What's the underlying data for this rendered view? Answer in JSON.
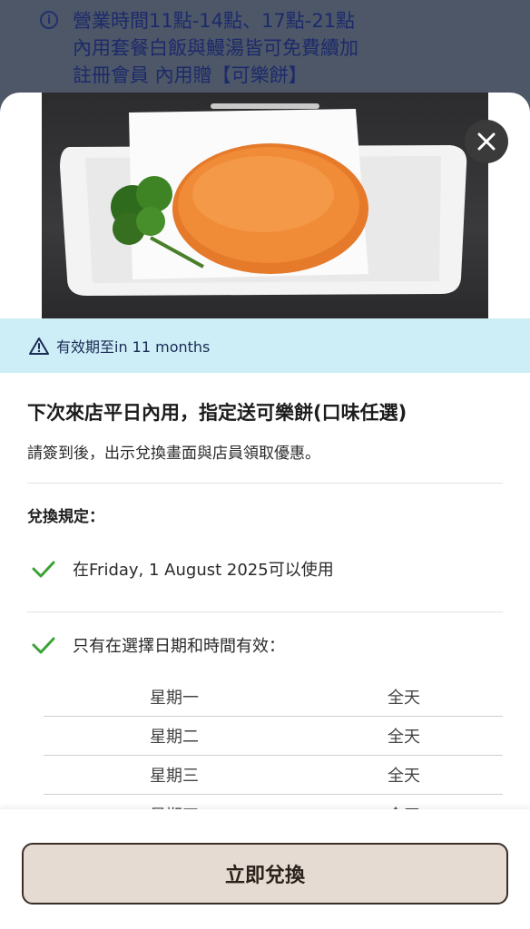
{
  "background_info": {
    "icon": "info-icon",
    "lines": [
      "營業時間11點-14點、17點-21點",
      "內用套餐白飯與鰻湯皆可免費續加",
      "註冊會員 內用贈【可樂餅】"
    ]
  },
  "sheet": {
    "close_icon": "close-icon",
    "validity": {
      "icon": "warning-icon",
      "text": "有效期至in 11 months"
    },
    "offer": {
      "title": "下次來店平日內用，指定送可樂餅(口味任選)",
      "description": "請簽到後，出示兌換畫面與店員領取優惠。"
    },
    "rules": {
      "title": "兌換規定：",
      "items": [
        {
          "icon": "check-icon",
          "text": "在Friday, 1 August 2025可以使用"
        },
        {
          "icon": "check-icon",
          "text": "只有在選擇日期和時間有效："
        }
      ],
      "schedule": [
        {
          "day": "星期一",
          "time": "全天"
        },
        {
          "day": "星期二",
          "time": "全天"
        },
        {
          "day": "星期三",
          "time": "全天"
        },
        {
          "day": "星期四",
          "time": "全天"
        }
      ]
    },
    "redeem_button": "立即兌換"
  },
  "colors": {
    "validity_bg": "#cdeef6",
    "check_green": "#3aa335",
    "button_bg": "#e6dbd2",
    "overlay": "#4d5767"
  }
}
